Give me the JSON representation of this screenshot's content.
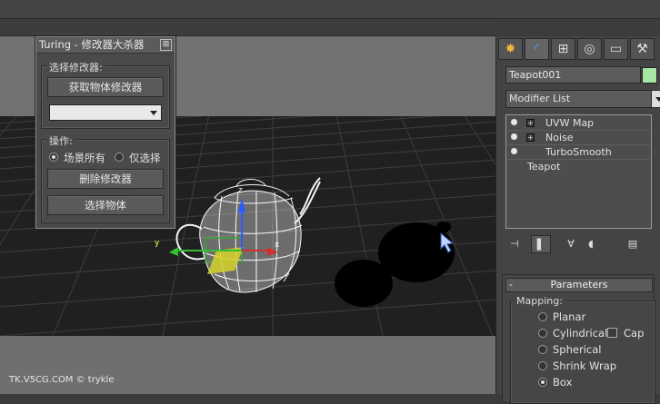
{
  "colors": {
    "viewport_bg": "#707070",
    "grid_floor": "#202020",
    "panel_bg": "#4a4a4a",
    "object_color_swatch": "#a8e6a4"
  },
  "viewport": {
    "watermark": "TK.V5CG.COM © trykle",
    "gizmo": {
      "x_label": "x",
      "y_label": "y",
      "z_label": "z"
    }
  },
  "turing_panel": {
    "title": "Turing - 修改器大杀器",
    "close_glyph": "⊠",
    "select_group_label": "选择修改器:",
    "get_modifiers_button": "获取物体修改器",
    "modifier_combo_value": "",
    "ops_group_label": "操作:",
    "radio_scene_all": "场景所有",
    "radio_selected_only": "仅选择",
    "delete_button": "删除修改器",
    "select_objects_button": "选择物体"
  },
  "command_panel": {
    "tabs": [
      {
        "name": "create-tab",
        "glyph": "✸"
      },
      {
        "name": "modify-tab",
        "glyph": "◜"
      },
      {
        "name": "hierarchy-tab",
        "glyph": "⊞"
      },
      {
        "name": "motion-tab",
        "glyph": "◎"
      },
      {
        "name": "display-tab",
        "glyph": "▭"
      },
      {
        "name": "utilities-tab",
        "glyph": "⚒"
      }
    ],
    "object_name": "Teapot001",
    "modifier_list_label": "Modifier List",
    "stack": [
      {
        "label": "UVW Map",
        "has_bulb": true,
        "has_plus": true
      },
      {
        "label": "Noise",
        "has_bulb": true,
        "has_plus": true
      },
      {
        "label": "TurboSmooth",
        "has_bulb": true,
        "has_plus": false
      },
      {
        "label": "Teapot",
        "has_bulb": false,
        "has_plus": false
      }
    ],
    "stack_tools": [
      "pin-stack",
      "show-end-result",
      "make-unique",
      "remove-modifier",
      "configure-sets"
    ],
    "parameters": {
      "rollout_title": "Parameters",
      "collapse_glyph": "-",
      "mapping_label": "Mapping:",
      "options": [
        "Planar",
        "Cylindrical",
        "Spherical",
        "Shrink Wrap",
        "Box"
      ],
      "selected": "Box",
      "cap_label": "Cap"
    }
  }
}
